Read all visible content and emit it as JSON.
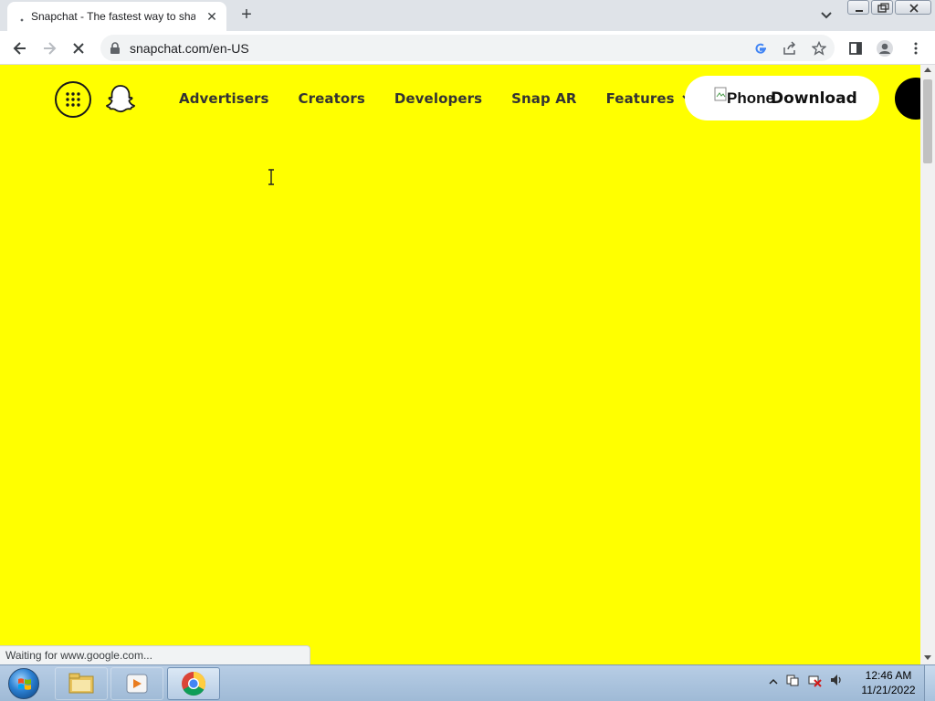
{
  "browser": {
    "tab": {
      "title": "Snapchat - The fastest way to sha",
      "close_label": "✕"
    },
    "new_tab_label": "+",
    "url": "snapchat.com/en-US"
  },
  "page": {
    "nav_links": [
      "Advertisers",
      "Creators",
      "Developers",
      "Snap AR"
    ],
    "features_label": "Features",
    "download_button": {
      "broken_image_alt": "Phone",
      "label": "Download"
    }
  },
  "status_text": "Waiting for www.google.com...",
  "taskbar": {
    "clock_time": "12:46 AM",
    "clock_date": "11/21/2022"
  },
  "colors": {
    "page_background": "#ffff00",
    "brand_text": "#333333"
  }
}
